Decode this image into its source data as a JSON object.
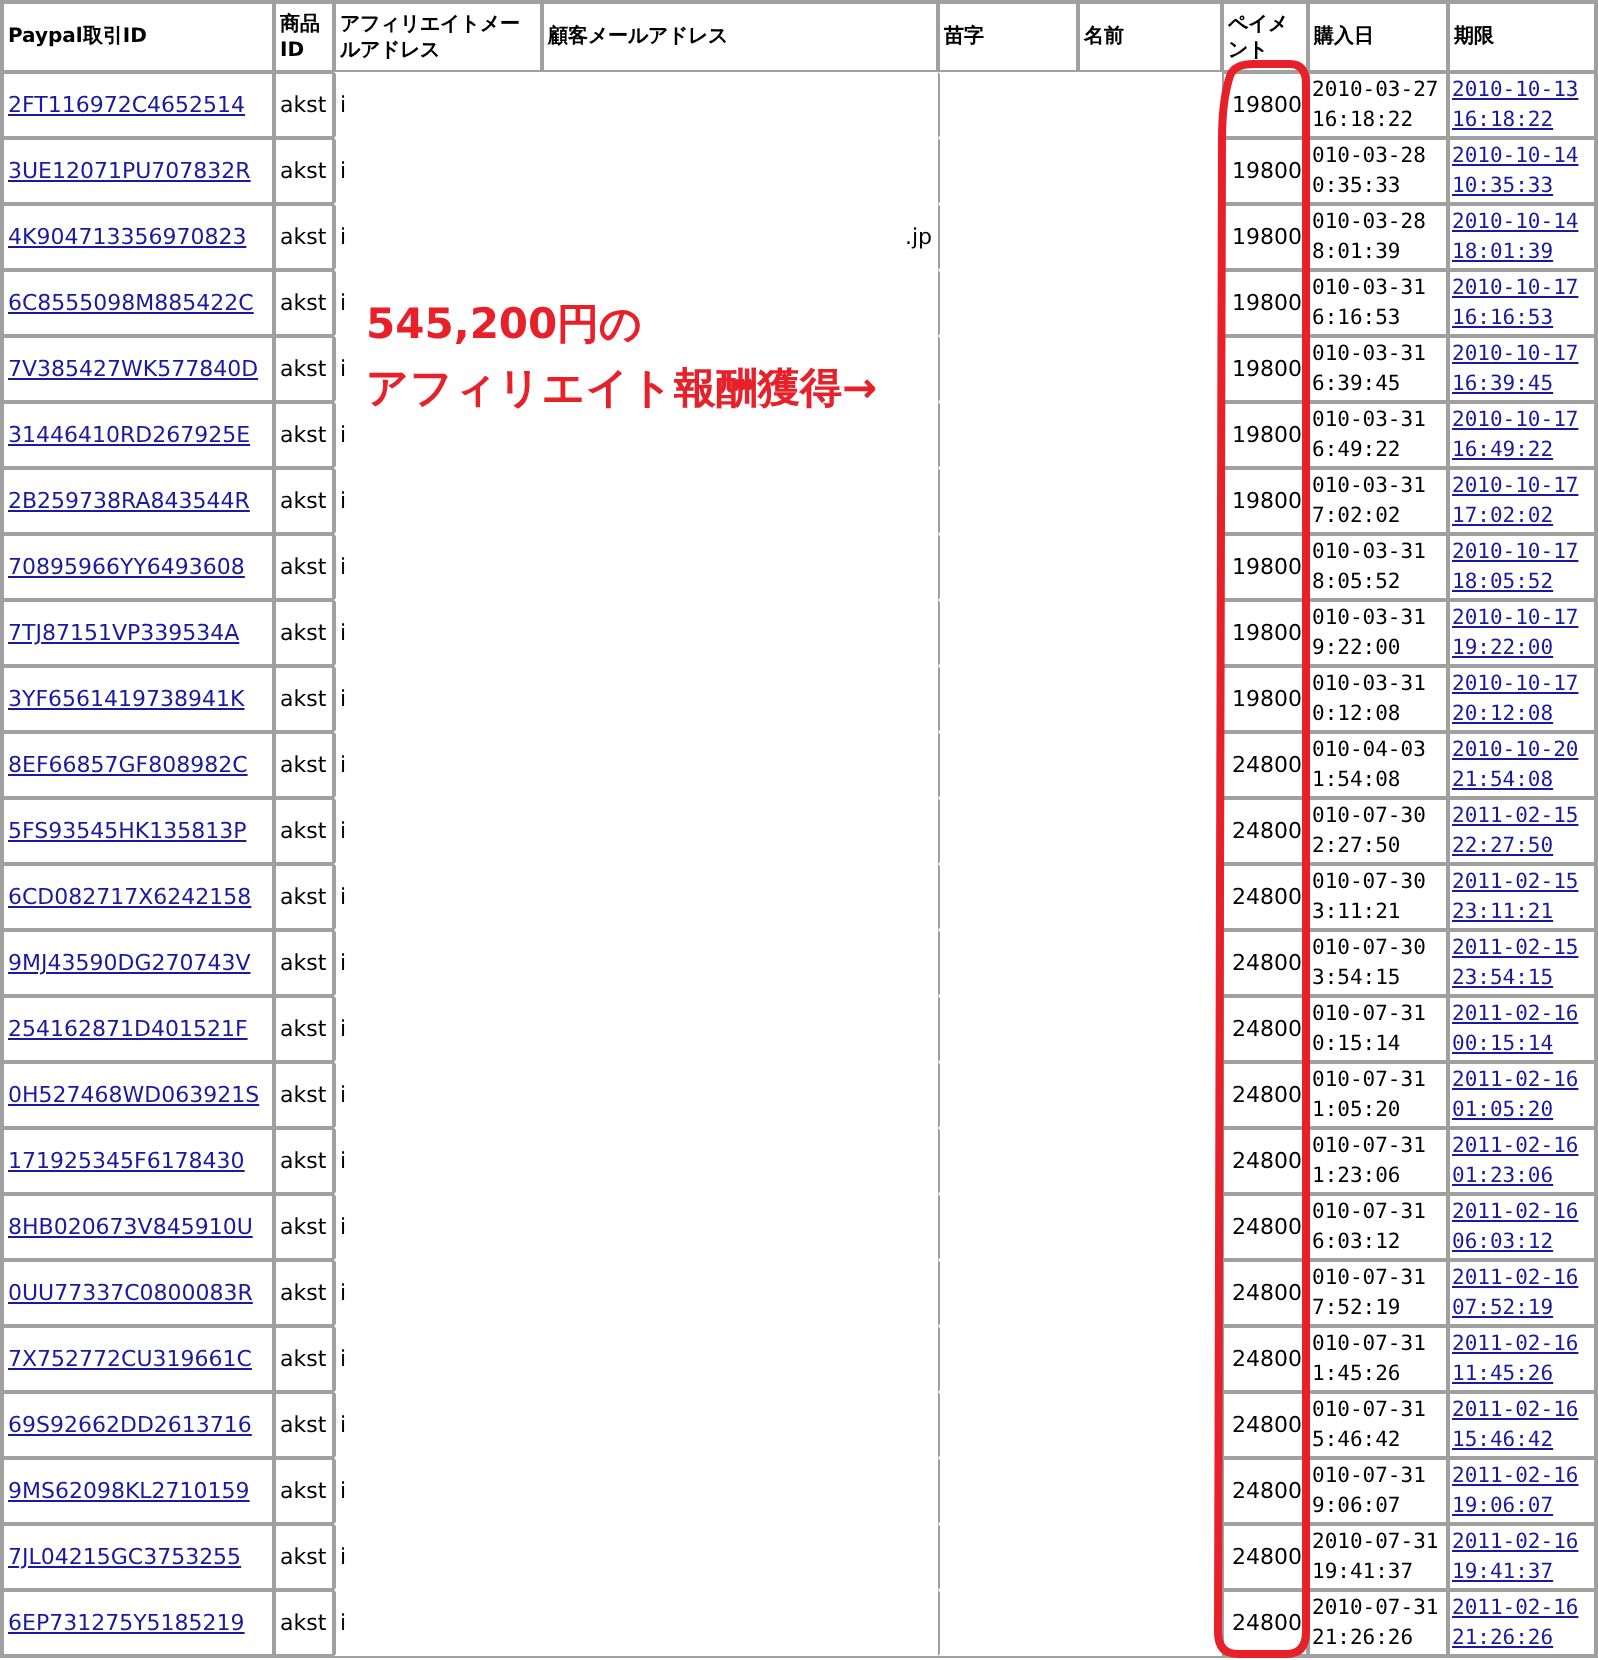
{
  "table": {
    "columns": [
      "Paypal取引ID",
      "商品ID",
      "アフィリエイトメールアドレス",
      "顧客メールアドレス",
      "苗字",
      "名前",
      "ペイメント",
      "購入日",
      "期限"
    ],
    "rows": [
      {
        "transaction_id": "2FT116972C4652514",
        "product_id": "akst",
        "affiliate_email": "i",
        "payment": "19800",
        "purchased": "2010-03-27 16:18:22",
        "expires": "2010-10-13 16:18:22"
      },
      {
        "transaction_id": "3UE12071PU707832R",
        "product_id": "akst",
        "affiliate_email": "i",
        "payment": "19800",
        "purchased": "010-03-28 0:35:33",
        "expires": "2010-10-14 10:35:33"
      },
      {
        "transaction_id": "4K904713356970823",
        "product_id": "akst",
        "affiliate_email": "i",
        "customer_email": ".jp",
        "payment": "19800",
        "purchased": "010-03-28 8:01:39",
        "expires": "2010-10-14 18:01:39"
      },
      {
        "transaction_id": "6C8555098M885422C",
        "product_id": "akst",
        "affiliate_email": "i",
        "payment": "19800",
        "purchased": "010-03-31 6:16:53",
        "expires": "2010-10-17 16:16:53"
      },
      {
        "transaction_id": "7V385427WK577840D",
        "product_id": "akst",
        "affiliate_email": "i",
        "payment": "19800",
        "purchased": "010-03-31 6:39:45",
        "expires": "2010-10-17 16:39:45"
      },
      {
        "transaction_id": "31446410RD267925E",
        "product_id": "akst",
        "affiliate_email": "i",
        "payment": "19800",
        "purchased": "010-03-31 6:49:22",
        "expires": "2010-10-17 16:49:22"
      },
      {
        "transaction_id": "2B259738RA843544R",
        "product_id": "akst",
        "affiliate_email": "i",
        "payment": "19800",
        "purchased": "010-03-31 7:02:02",
        "expires": "2010-10-17 17:02:02"
      },
      {
        "transaction_id": "70895966YY6493608",
        "product_id": "akst",
        "affiliate_email": "i",
        "payment": "19800",
        "purchased": "010-03-31 8:05:52",
        "expires": "2010-10-17 18:05:52"
      },
      {
        "transaction_id": "7TJ87151VP339534A",
        "product_id": "akst",
        "affiliate_email": "i",
        "payment": "19800",
        "purchased": "010-03-31 9:22:00",
        "expires": "2010-10-17 19:22:00"
      },
      {
        "transaction_id": "3YF6561419738941K",
        "product_id": "akst",
        "affiliate_email": "i",
        "payment": "19800",
        "purchased": "010-03-31 0:12:08",
        "expires": "2010-10-17 20:12:08"
      },
      {
        "transaction_id": "8EF66857GF808982C",
        "product_id": "akst",
        "affiliate_email": "i",
        "payment": "24800",
        "purchased": "010-04-03 1:54:08",
        "expires": "2010-10-20 21:54:08"
      },
      {
        "transaction_id": "5FS93545HK135813P",
        "product_id": "akst",
        "affiliate_email": "i",
        "payment": "24800",
        "purchased": "010-07-30 2:27:50",
        "expires": "2011-02-15 22:27:50"
      },
      {
        "transaction_id": "6CD082717X6242158",
        "product_id": "akst",
        "affiliate_email": "i",
        "payment": "24800",
        "purchased": "010-07-30 3:11:21",
        "expires": "2011-02-15 23:11:21"
      },
      {
        "transaction_id": "9MJ43590DG270743V",
        "product_id": "akst",
        "affiliate_email": "i",
        "payment": "24800",
        "purchased": "010-07-30 3:54:15",
        "expires": "2011-02-15 23:54:15"
      },
      {
        "transaction_id": "254162871D401521F",
        "product_id": "akst",
        "affiliate_email": "i",
        "payment": "24800",
        "purchased": "010-07-31 0:15:14",
        "expires": "2011-02-16 00:15:14"
      },
      {
        "transaction_id": "0H527468WD063921S",
        "product_id": "akst",
        "affiliate_email": "i",
        "payment": "24800",
        "purchased": "010-07-31 1:05:20",
        "expires": "2011-02-16 01:05:20"
      },
      {
        "transaction_id": "171925345F6178430",
        "product_id": "akst",
        "affiliate_email": "i",
        "payment": "24800",
        "purchased": "010-07-31 1:23:06",
        "expires": "2011-02-16 01:23:06"
      },
      {
        "transaction_id": "8HB020673V845910U",
        "product_id": "akst",
        "affiliate_email": "i",
        "payment": "24800",
        "purchased": "010-07-31 6:03:12",
        "expires": "2011-02-16 06:03:12"
      },
      {
        "transaction_id": "0UU77337C0800083R",
        "product_id": "akst",
        "affiliate_email": "i",
        "payment": "24800",
        "purchased": "010-07-31 7:52:19",
        "expires": "2011-02-16 07:52:19"
      },
      {
        "transaction_id": "7X752772CU319661C",
        "product_id": "akst",
        "affiliate_email": "i",
        "payment": "24800",
        "purchased": "010-07-31 1:45:26",
        "expires": "2011-02-16 11:45:26"
      },
      {
        "transaction_id": "69S92662DD2613716",
        "product_id": "akst",
        "affiliate_email": "i",
        "payment": "24800",
        "purchased": "010-07-31 5:46:42",
        "expires": "2011-02-16 15:46:42"
      },
      {
        "transaction_id": "9MS62098KL2710159",
        "product_id": "akst",
        "affiliate_email": "i",
        "payment": "24800",
        "purchased": "010-07-31 9:06:07",
        "expires": "2011-02-16 19:06:07"
      },
      {
        "transaction_id": "7JL04215GC3753255",
        "product_id": "akst",
        "affiliate_email": "i",
        "payment": "24800",
        "purchased": "2010-07-31 19:41:37",
        "expires": "2011-02-16 19:41:37"
      },
      {
        "transaction_id": "6EP731275Y5185219",
        "product_id": "akst",
        "affiliate_email": "i",
        "payment": "24800",
        "purchased": "2010-07-31 21:26:26",
        "expires": "2011-02-16 21:26:26"
      }
    ]
  },
  "annotation": {
    "lines": [
      "545,200円の",
      "アフィリエイト報酬獲得→"
    ]
  }
}
